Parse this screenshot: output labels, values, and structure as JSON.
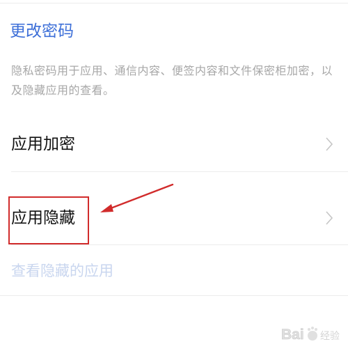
{
  "settings": {
    "change_password": "更改密码",
    "description": "隐私密码用于应用、通信内容、便签内容和文件保密柜加密，以及隐藏应用的查看。",
    "rows": [
      {
        "label": "应用加密"
      },
      {
        "label": "应用隐藏"
      }
    ],
    "view_hidden": "查看隐藏的应用"
  },
  "annotation": {
    "color": "#d12b2b"
  },
  "colors": {
    "link": "#3d6fd8",
    "muted": "#a7a7a7",
    "disabled_link": "#c9d6ef"
  },
  "watermark": {
    "text": "Bai 经验"
  }
}
